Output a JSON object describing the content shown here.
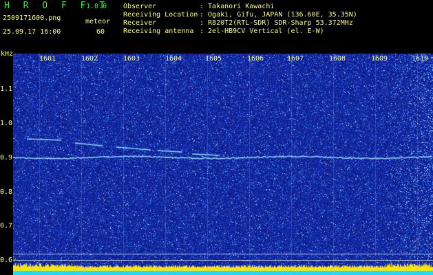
{
  "header": {
    "app_name": "H R O F F T",
    "version": "1.0.0",
    "filename": "2509171600.png",
    "datetime": "25.09.17 16:00",
    "meteor_label": "meteor",
    "meteor_count": "60",
    "info": [
      {
        "key": "Observer",
        "value": ": Takanori Kawachi"
      },
      {
        "key": "Receiving Location",
        "value": ": Ogaki, Gifu, JAPAN (136.60E, 35.35N)"
      },
      {
        "key": "Receiver",
        "value": ": R820T2(RTL-SDR) SDR-Sharp 53.372MHz"
      },
      {
        "key": "Receiving antenna",
        "value": ": 2el-HB9CV Vertical (el. E-W)"
      }
    ]
  },
  "axis": {
    "y_unit": "kHz",
    "y_ticks": [
      "1.1",
      "1.0",
      "0.9",
      "0.8",
      "0.7",
      "0.6"
    ],
    "x_ticks": [
      "1601",
      "1602",
      "1603",
      "1604",
      "1605",
      "1606",
      "1607",
      "1608",
      "1609",
      "1610"
    ]
  },
  "colors": {
    "background": "#0a1f86",
    "header_text": "#ffff66",
    "title_text": "#3cf03c",
    "echo": "#9ff6ff"
  }
}
